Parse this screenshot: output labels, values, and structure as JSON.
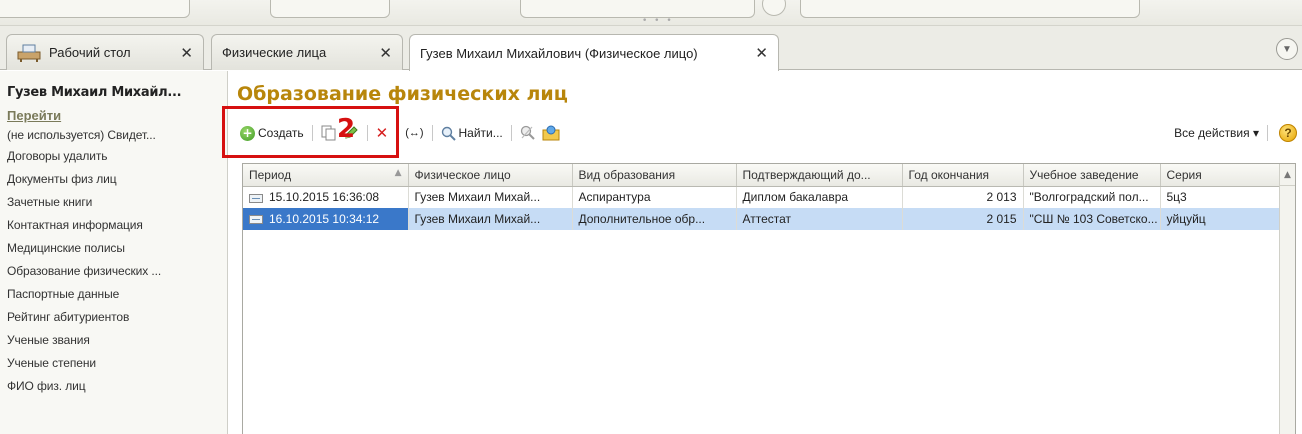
{
  "tabs": [
    {
      "label": "Рабочий стол"
    },
    {
      "label": "Физические лица"
    },
    {
      "label": "Гузев Михаил Михайлович (Физическое лицо)"
    }
  ],
  "sidebar": {
    "title": "Гузев Михаил Михайл...",
    "goto": "Перейти",
    "items": [
      {
        "label": "(не используется) Свидет..."
      },
      {
        "label": "Договоры удалить"
      },
      {
        "label": "Документы физ лиц"
      },
      {
        "label": "Зачетные книги"
      },
      {
        "label": "Контактная информация"
      },
      {
        "label": "Медицинские полисы"
      },
      {
        "label": "Образование физических ..."
      },
      {
        "label": "Паспортные данные"
      },
      {
        "label": "Рейтинг абитуриентов"
      },
      {
        "label": "Ученые звания"
      },
      {
        "label": "Ученые степени"
      },
      {
        "label": "ФИО физ. лиц"
      }
    ]
  },
  "main": {
    "title": "Образование физических лиц",
    "toolbar": {
      "create": "Создать",
      "move": "(↔)",
      "find": "Найти...",
      "all_actions": "Все действия ▾",
      "help": "?"
    },
    "annotation_number": "2",
    "table": {
      "columns": [
        "Период",
        "Физическое лицо",
        "Вид образования",
        "Подтверждающий до...",
        "Год окончания",
        "Учебное заведение",
        "Серия"
      ],
      "rows": [
        [
          "15.10.2015 16:36:08",
          "Гузев Михаил Михай...",
          "Аспирантура",
          "Диплом бакалавра",
          "2 013",
          "\"Волгоградский пол...",
          "5ц3"
        ],
        [
          "16.10.2015 10:34:12",
          "Гузев Михаил Михай...",
          "Дополнительное обр...",
          "Аттестат",
          "2 015",
          "\"СШ № 103 Советско...",
          "уйцуйц"
        ]
      ],
      "selected_row": 1
    }
  },
  "colors": {
    "accent_title": "#b8860b",
    "selection": "#c6dcf5",
    "selected_cell": "#3a78c9",
    "annotation": "#d61010"
  }
}
